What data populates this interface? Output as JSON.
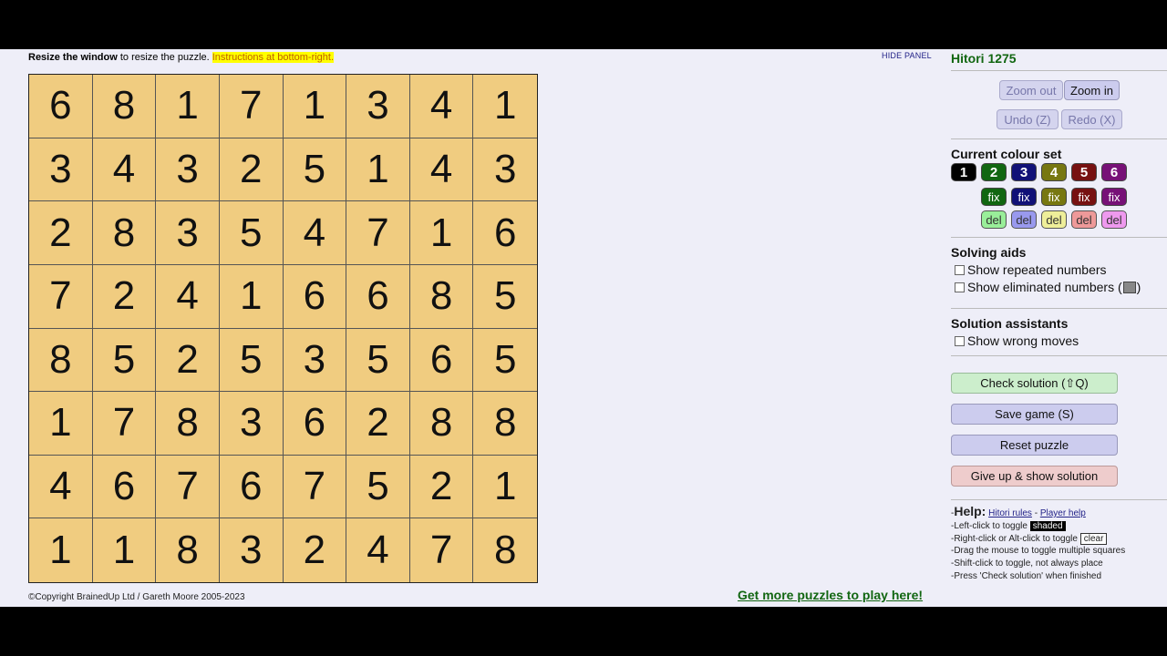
{
  "top_bar": {
    "instr_bold": "Resize the window",
    "instr_text": " to resize the puzzle. ",
    "instr_highlight": "Instructions at bottom-right.",
    "hide_panel": "HIDE PANEL"
  },
  "puzzle": {
    "rows": [
      [
        6,
        8,
        1,
        7,
        1,
        3,
        4,
        1
      ],
      [
        3,
        4,
        3,
        2,
        5,
        1,
        4,
        3
      ],
      [
        2,
        8,
        3,
        5,
        4,
        7,
        1,
        6
      ],
      [
        7,
        2,
        4,
        1,
        6,
        6,
        8,
        5
      ],
      [
        8,
        5,
        2,
        5,
        3,
        5,
        6,
        5
      ],
      [
        1,
        7,
        8,
        3,
        6,
        2,
        8,
        8
      ],
      [
        4,
        6,
        7,
        6,
        7,
        5,
        2,
        1
      ],
      [
        1,
        1,
        8,
        3,
        2,
        4,
        7,
        8
      ]
    ]
  },
  "footer": {
    "copyright": "©Copyright BrainedUp Ltd / Gareth Moore 2005-2023",
    "get_more": "Get more puzzles to play here!"
  },
  "panel": {
    "title": "Hitori 1275",
    "zoom_out": "Zoom out",
    "zoom_in": "Zoom in",
    "undo": "Undo (Z)",
    "redo": "Redo (X)",
    "colour_set_title": "Current colour set",
    "swatches": [
      {
        "label": "1",
        "color": "#000000"
      },
      {
        "label": "2",
        "color": "#116611"
      },
      {
        "label": "3",
        "color": "#111177"
      },
      {
        "label": "4",
        "color": "#777711"
      },
      {
        "label": "5",
        "color": "#771111"
      },
      {
        "label": "6",
        "color": "#771177"
      }
    ],
    "fix_label": "fix",
    "del_label": "del",
    "fix_colors": [
      "#116611",
      "#111177",
      "#777711",
      "#771111",
      "#771177"
    ],
    "del_colors": [
      "#99ee99",
      "#9999ee",
      "#eeee99",
      "#ee9999",
      "#ee99ee"
    ],
    "solving_aids_title": "Solving aids",
    "show_repeated": "Show repeated numbers",
    "show_eliminated": "Show eliminated numbers (",
    "show_eliminated_end": ")",
    "solution_assistants_title": "Solution assistants",
    "show_wrong": "Show wrong moves",
    "check_solution": "Check solution (⇧Q)",
    "save_game": "Save game (S)",
    "reset_puzzle": "Reset puzzle",
    "give_up": "Give up & show solution",
    "help": {
      "prefix": "-",
      "heading": "Help:",
      "rules_link": "Hitori rules",
      "sep": " - ",
      "player_help": "Player help",
      "line1_a": "-Left-click to toggle ",
      "line1_b": "shaded",
      "line2_a": "-Right-click or Alt-click to toggle ",
      "line2_b": "clear",
      "line3": "-Drag the mouse to toggle multiple squares",
      "line4": "-Shift-click to toggle, not always place",
      "line5": "-Press 'Check solution' when finished"
    }
  }
}
